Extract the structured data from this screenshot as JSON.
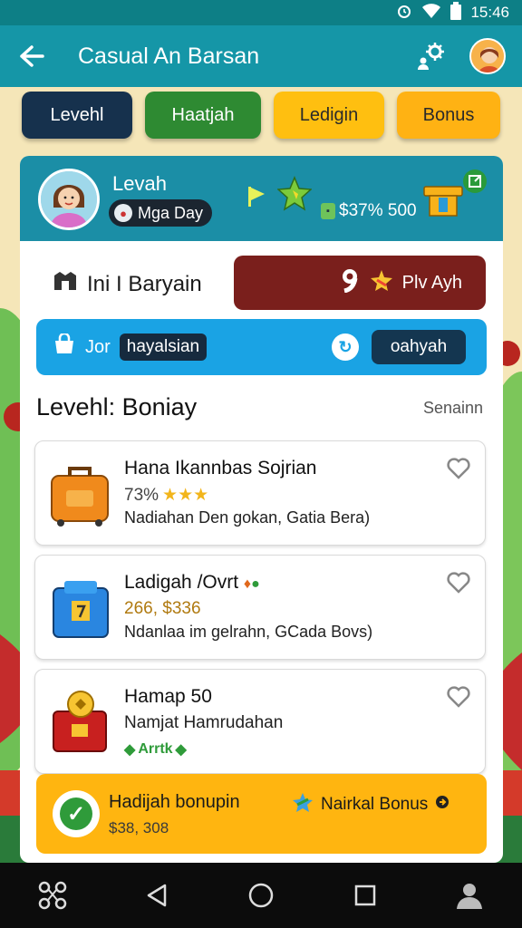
{
  "status_bar": {
    "time": "15:46",
    "icons": [
      "alarm-icon",
      "wifi-icon",
      "battery-icon"
    ]
  },
  "app_bar": {
    "title": "Casual An Barsan",
    "back_icon": "arrow-left-icon",
    "action_icon": "gear-person-icon",
    "avatar_icon": "user-avatar-icon"
  },
  "tabs": [
    {
      "label": "Levehl",
      "color": "#16314d"
    },
    {
      "label": "Haatjah",
      "color": "#2e8a32"
    },
    {
      "label": "Ledigin",
      "color": "#ffbf10"
    },
    {
      "label": "Bonus",
      "color": "#ffb213"
    }
  ],
  "profile": {
    "name": "Levah",
    "day_label": "Mga Day",
    "coins": "$37% 500"
  },
  "bargain": {
    "label": "Ini I Baryain",
    "button_label": "Plv Ayh"
  },
  "join": {
    "prefix": "Jor",
    "chip": "hayalsian",
    "button_label": "oahyah"
  },
  "section": {
    "title": "Levehl: Boniay",
    "link": "Senainn"
  },
  "items": [
    {
      "title": "Hana Ikannbas Sojrian",
      "sub": "73%",
      "stars": "★★★",
      "desc": "Nadiahan Den gokan, Gatia Bera)"
    },
    {
      "title": "Ladigah /Ovrt",
      "sub": "266, $336",
      "stars": "",
      "desc": "Ndanlaa im gelrahn, GCada Bovs)"
    },
    {
      "title": "Hamap 50",
      "sub": "Namjat Hamrudahan",
      "stars": "",
      "desc": "Arrtk"
    }
  ],
  "bonus_bar": {
    "title": "Hadijah bonupin",
    "value": "$38, 308",
    "link": "Nairkal Bonus"
  },
  "nav_bar": {
    "icons": [
      "share-icon",
      "back-triangle-icon",
      "home-circle-icon",
      "recents-square-icon",
      "profile-icon"
    ]
  },
  "colors": {
    "primary": "#1596a7",
    "status": "#0d7f86",
    "accent": "#ffb510",
    "danger": "#7a1f1c",
    "info": "#1aa3e4"
  }
}
